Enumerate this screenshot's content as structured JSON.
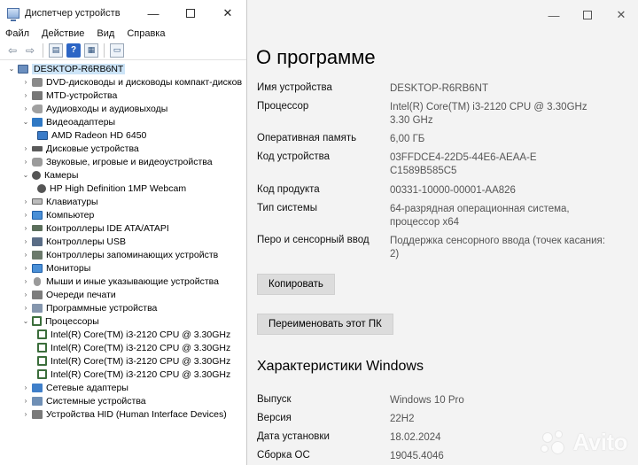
{
  "device_manager": {
    "title": "Диспетчер устройств",
    "menu": [
      "Файл",
      "Действие",
      "Вид",
      "Справка"
    ],
    "window_controls": {
      "minimize": "—",
      "maximize": "",
      "close": "✕"
    },
    "toolbar": [
      "back-icon",
      "forward-icon",
      "properties-icon",
      "help-icon",
      "view-icon",
      "monitor-icon"
    ],
    "tree": {
      "root": "DESKTOP-R6RB6NT",
      "categories": [
        {
          "label": "DVD-дисководы и дисководы компакт-дисков",
          "icon": "disc-drive-icon",
          "expanded": false
        },
        {
          "label": "MTD-устройства",
          "icon": "mtd-icon",
          "expanded": false
        },
        {
          "label": "Аудиовходы и аудиовыходы",
          "icon": "audio-io-icon",
          "expanded": false
        },
        {
          "label": "Видеоадаптеры",
          "icon": "display-adapter-icon",
          "expanded": true,
          "children": [
            "AMD Radeon HD 6450"
          ]
        },
        {
          "label": "Дисковые устройства",
          "icon": "disk-drive-icon",
          "expanded": false
        },
        {
          "label": "Звуковые, игровые и видеоустройства",
          "icon": "sound-icon",
          "expanded": false
        },
        {
          "label": "Камеры",
          "icon": "camera-icon",
          "expanded": true,
          "children": [
            "HP High Definition 1MP Webcam"
          ]
        },
        {
          "label": "Клавиатуры",
          "icon": "keyboard-icon",
          "expanded": false
        },
        {
          "label": "Компьютер",
          "icon": "computer-icon",
          "expanded": false
        },
        {
          "label": "Контроллеры IDE ATA/ATAPI",
          "icon": "ide-controller-icon",
          "expanded": false
        },
        {
          "label": "Контроллеры USB",
          "icon": "usb-controller-icon",
          "expanded": false
        },
        {
          "label": "Контроллеры запоминающих устройств",
          "icon": "storage-controller-icon",
          "expanded": false
        },
        {
          "label": "Мониторы",
          "icon": "monitor-icon",
          "expanded": false
        },
        {
          "label": "Мыши и иные указывающие устройства",
          "icon": "mouse-icon",
          "expanded": false
        },
        {
          "label": "Очереди печати",
          "icon": "printer-icon",
          "expanded": false
        },
        {
          "label": "Программные устройства",
          "icon": "software-device-icon",
          "expanded": false
        },
        {
          "label": "Процессоры",
          "icon": "processor-icon",
          "expanded": true,
          "children": [
            "Intel(R) Core(TM) i3-2120 CPU @ 3.30GHz",
            "Intel(R) Core(TM) i3-2120 CPU @ 3.30GHz",
            "Intel(R) Core(TM) i3-2120 CPU @ 3.30GHz",
            "Intel(R) Core(TM) i3-2120 CPU @ 3.30GHz"
          ]
        },
        {
          "label": "Сетевые адаптеры",
          "icon": "network-adapter-icon",
          "expanded": false
        },
        {
          "label": "Системные устройства",
          "icon": "system-device-icon",
          "expanded": false
        },
        {
          "label": "Устройства HID (Human Interface Devices)",
          "icon": "hid-icon",
          "expanded": false
        }
      ]
    }
  },
  "settings": {
    "window_controls": {
      "minimize": "—",
      "maximize": "",
      "close": "✕"
    },
    "title": "О программе",
    "specs": [
      {
        "label": "Имя устройства",
        "value": "DESKTOP-R6RB6NT"
      },
      {
        "label": "Процессор",
        "value": "Intel(R) Core(TM) i3-2120 CPU @ 3.30GHz 3.30 GHz"
      },
      {
        "label": "Оперативная память",
        "value": "6,00 ГБ"
      },
      {
        "label": "Код устройства",
        "value": "03FFDCE4-22D5-44E6-AEAA-EC1589B585C5"
      },
      {
        "label": "Код продукта",
        "value": "00331-10000-00001-AA826"
      },
      {
        "label": "Тип системы",
        "value": "64-разрядная операционная система, процессор x64"
      },
      {
        "label": "Перо и сенсорный ввод",
        "value": "Поддержка сенсорного ввода (точек касания: 2)"
      }
    ],
    "copy_button": "Копировать",
    "rename_button": "Переименовать этот ПК",
    "windows_section_title": "Характеристики Windows",
    "windows_specs": [
      {
        "label": "Выпуск",
        "value": "Windows 10 Pro"
      },
      {
        "label": "Версия",
        "value": "22H2"
      },
      {
        "label": "Дата установки",
        "value": "18.02.2024"
      },
      {
        "label": "Сборка ОС",
        "value": "19045.4046"
      }
    ]
  },
  "watermark": {
    "text": "Avito"
  }
}
